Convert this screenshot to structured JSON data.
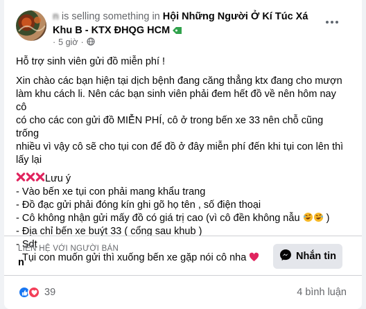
{
  "post": {
    "author": "n",
    "selling_text": " is selling something in ",
    "group_name": "Hội Những Người Ở Kí Túc Xá Khu B - KTX ĐHQG HCM",
    "timestamp": "5 giờ",
    "visibility_icon": "globe-icon",
    "group_tag_icon": "price-tag-icon"
  },
  "body": {
    "title": "Hỗ trợ sinh viên gửi đồ miễn phí !",
    "paragraph": [
      "Xin chào các bạn hiện tại dịch bệnh đang căng thẳng ktx đang cho mượn",
      "làm khu cách li. Nên các bạn sinh viên phải đem hết đồ về nên hôm nay cô",
      "có cho các con gửi đồ MIỄN PHÍ, cô ở trong bến xe 33 nên chỗ cũng trống",
      "nhiều vì vậy cô sẽ cho tụi con để đồ ở đây miễn phí đến khi tụi con lên thì",
      "lấy lại"
    ],
    "note_heading": "Lưu ý",
    "notes": [
      "-  Vào bến xe tụi con phải mang khẩu trang",
      "- Đồ đạc gửi phải đóng kín ghi gõ họ tên , số điện thoại",
      "- Cô không nhận gửi mấy đồ có giá trị cao (vì cô đền không nẫu",
      "- Địa chỉ bến xe buýt 33 ( cổng sau khub )",
      "- Sdt"
    ],
    "note_3_suffix": ")",
    "closing": "Tụi con muốn gửi thì xuống bến xe gặp nói cô nha"
  },
  "seller": {
    "label": "Liên hệ với người bán",
    "name": "n",
    "message_button": "Nhắn tin"
  },
  "footer": {
    "reaction_count": "39",
    "comment_count": "4 bình luận"
  },
  "colors": {
    "primary": "#1877f2",
    "secondary_text": "#65676b",
    "love": "#f33e58",
    "cross": "#e0245e",
    "tag_green": "#31a24c"
  }
}
